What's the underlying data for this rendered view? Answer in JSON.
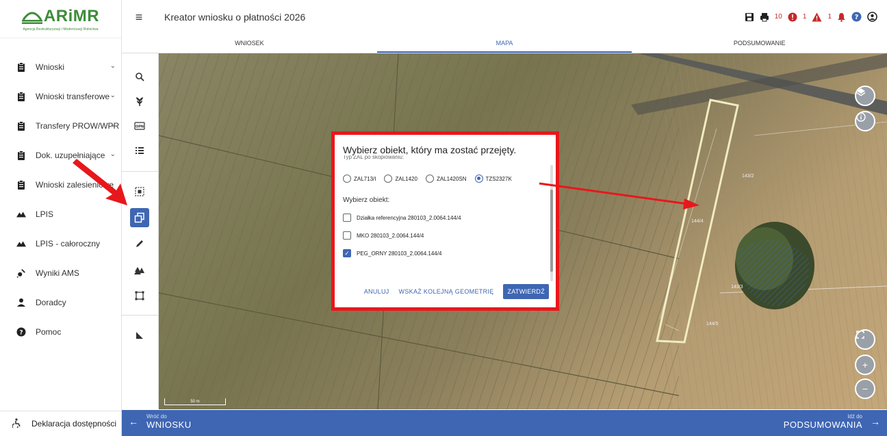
{
  "app": {
    "logo_text": "ARiMR",
    "logo_subtitle": "Agencja Restrukturyzacji i Modernizacji Rolnictwa",
    "title": "Kreator wniosku o płatności 2026"
  },
  "header": {
    "counters": [
      "10",
      "1",
      "1"
    ]
  },
  "sidebar": {
    "items": [
      {
        "label": "Wnioski",
        "icon": "clipboard-icon",
        "has_chevron": true
      },
      {
        "label": "Wnioski transferowe",
        "icon": "clipboard-icon",
        "has_chevron": true
      },
      {
        "label": "Transfery PROW/WPR",
        "icon": "clipboard-icon",
        "has_chevron": true
      },
      {
        "label": "Dok. uzupełniające",
        "icon": "clipboard-icon",
        "has_chevron": true
      },
      {
        "label": "Wnioski zalesieniowe",
        "icon": "clipboard-icon",
        "has_chevron": false
      },
      {
        "label": "LPIS",
        "icon": "mountain-icon",
        "has_chevron": false
      },
      {
        "label": "LPIS - całoroczny",
        "icon": "mountain-icon",
        "has_chevron": false
      },
      {
        "label": "Wyniki AMS",
        "icon": "satellite-icon",
        "has_chevron": false
      },
      {
        "label": "Doradcy",
        "icon": "person-icon",
        "has_chevron": false
      },
      {
        "label": "Pomoc",
        "icon": "help-icon",
        "has_chevron": false
      }
    ],
    "footer_label": "Deklaracja dostępności"
  },
  "tabs": [
    {
      "label": "WNIOSEK",
      "active": false
    },
    {
      "label": "MAPA",
      "active": true
    },
    {
      "label": "PODSUMOWANIE",
      "active": false
    }
  ],
  "map": {
    "scale_label": "50 m",
    "parcel_labels": [
      "143/2",
      "144/4",
      "143/3",
      "144/5"
    ]
  },
  "modal": {
    "title": "Wybierz obiekt, który ma zostać przejęty.",
    "scroll_hint": "Typ ZAL po skopiowaniu:",
    "radio_options": [
      {
        "label": "ZAL713/I",
        "selected": false
      },
      {
        "label": "ZAL1420",
        "selected": false
      },
      {
        "label": "ZAL1420SN",
        "selected": false
      },
      {
        "label": "TZS2327K",
        "selected": true
      }
    ],
    "select_label": "Wybierz obiekt:",
    "objects": [
      {
        "label": "Działka referencyjna 280103_2.0064.144/4",
        "checked": false
      },
      {
        "label": "MKO 280103_2.0064.144/4",
        "checked": false
      },
      {
        "label": "PEG_ORNY 280103_2.0064.144/4",
        "checked": true
      }
    ],
    "buttons": {
      "cancel": "ANULUJ",
      "next_geometry": "WSKAŻ KOLEJNĄ GEOMETRIĘ",
      "confirm": "ZATWIERDŹ"
    }
  },
  "footer": {
    "back_small": "Wróć do",
    "back_big": "WNIOSKU",
    "next_small": "Idź do",
    "next_big": "PODSUMOWANIA"
  },
  "colors": {
    "brand_green": "#3d8c3a",
    "primary_blue": "#3f66b3",
    "annotation_red": "#e8171b"
  }
}
